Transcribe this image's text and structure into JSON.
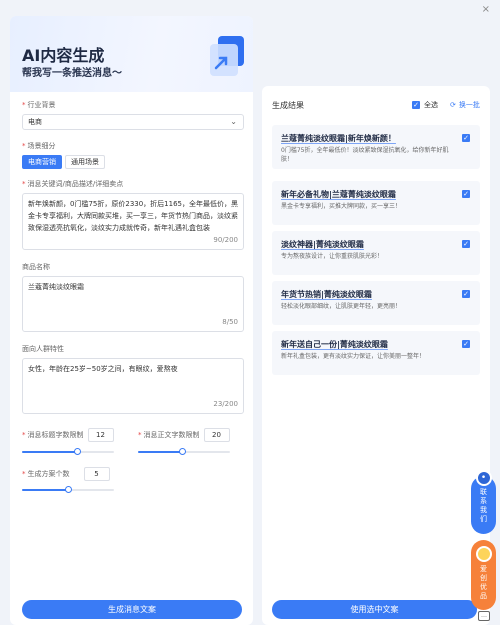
{
  "window": {
    "close_glyph": "×"
  },
  "hero": {
    "title": "AI内容生成",
    "subtitle": "帮我写一条推送消息～"
  },
  "form": {
    "industry": {
      "label": "行业背景",
      "value": "电商"
    },
    "scene": {
      "label": "场景细分",
      "options": [
        "电商营销",
        "通用场景"
      ],
      "selected": "电商营销"
    },
    "keywords": {
      "label": "消息关键词/商品描述/详细卖点",
      "value": "新年焕新颜，0门槛75折，原价2330，折后1165，全年最低价，黑金卡专享福利，大牌同款买堆，买一享三，年货节热门商品，淡纹紧致保湿透亮抗氧化，淡纹实力成就传奇，新年礼遇礼盒包装",
      "counter": "90/200"
    },
    "product_name": {
      "label": "商品名称",
      "value": "兰蔻菁纯淡纹眼霜",
      "counter": "8/50"
    },
    "audience": {
      "label": "面向人群特性",
      "value": "女性，年龄在25岁~50岁之间，有眼纹，爱熬夜",
      "counter": "23/200"
    },
    "title_limit": {
      "label": "消息标题字数限制",
      "value": "12",
      "level_percent": 60
    },
    "body_limit": {
      "label": "消息正文字数限制",
      "value": "20",
      "level_percent": 48
    },
    "plan_count": {
      "label": "生成方案个数",
      "value": "5",
      "level_percent": 50
    },
    "generate_button": "生成消息文案"
  },
  "results": {
    "header": "生成结果",
    "select_all": "全选",
    "refresh": "换一批",
    "items": [
      {
        "title": "兰蔻菁纯淡纹眼霜|新年焕新颜！",
        "desc": "0门槛75折，全年最低价！淡纹紧致保湿抗氧化，给你新年好肌肤！",
        "checked": true
      },
      {
        "title": "新年必备礼物|兰蔻菁纯淡纹眼霜",
        "desc": "黑金卡专享福利，买推大牌同款，买一享三！",
        "checked": true
      },
      {
        "title": "淡纹神器|菁纯淡纹眼霜",
        "desc": "专为熬夜族设计，让你重获肌肤光彩！",
        "checked": true
      },
      {
        "title": "年货节热销|菁纯淡纹眼霜",
        "desc": "轻松淡化眼部细纹，让肌肤更年轻，更亮丽！",
        "checked": true
      },
      {
        "title": "新年送自己一份|菁纯淡纹眼霜",
        "desc": "新年礼盒包装，更有淡纹实力保证，让你美丽一整年！",
        "checked": true
      }
    ],
    "use_button": "使用选中文案"
  },
  "float": {
    "contact": "联系我们",
    "vip": "爱创优品",
    "feedback_icon": "feedback-icon"
  },
  "colors": {
    "accent": "#3a7bf5",
    "orange": "#f6813a"
  }
}
